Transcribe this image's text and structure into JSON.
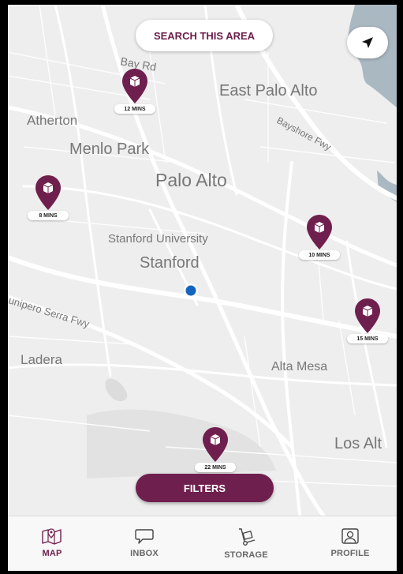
{
  "search_area_label": "SEARCH THIS AREA",
  "filters_label": "FILTERS",
  "map_labels": {
    "bay_rd": "Bay Rd",
    "east_palo_alto": "East Palo Alto",
    "atherton": "Atherton",
    "menlo_park": "Menlo Park",
    "bayshore_fwy": "Bayshore Fwy",
    "palo_alto": "Palo Alto",
    "stanford_university": "Stanford University",
    "stanford": "Stanford",
    "junipero_serra_fwy": "unipero Serra Fwy",
    "ladera": "Ladera",
    "alta_mesa": "Alta Mesa",
    "los_altos": "Los Alt"
  },
  "pins": [
    {
      "time": "12 MINS"
    },
    {
      "time": "8 MINS"
    },
    {
      "time": "10 MINS"
    },
    {
      "time": "15 MINS"
    },
    {
      "time": "22 MINS"
    }
  ],
  "tabs": [
    {
      "label": "MAP",
      "icon": "map-icon"
    },
    {
      "label": "INBOX",
      "icon": "chat-icon"
    },
    {
      "label": "STORAGE",
      "icon": "hand-truck-icon"
    },
    {
      "label": "PROFILE",
      "icon": "profile-icon"
    }
  ],
  "colors": {
    "accent": "#6f1f4e",
    "user_location": "#1565c0",
    "water": "#aab8c2",
    "map_bg": "#eeeeee"
  }
}
